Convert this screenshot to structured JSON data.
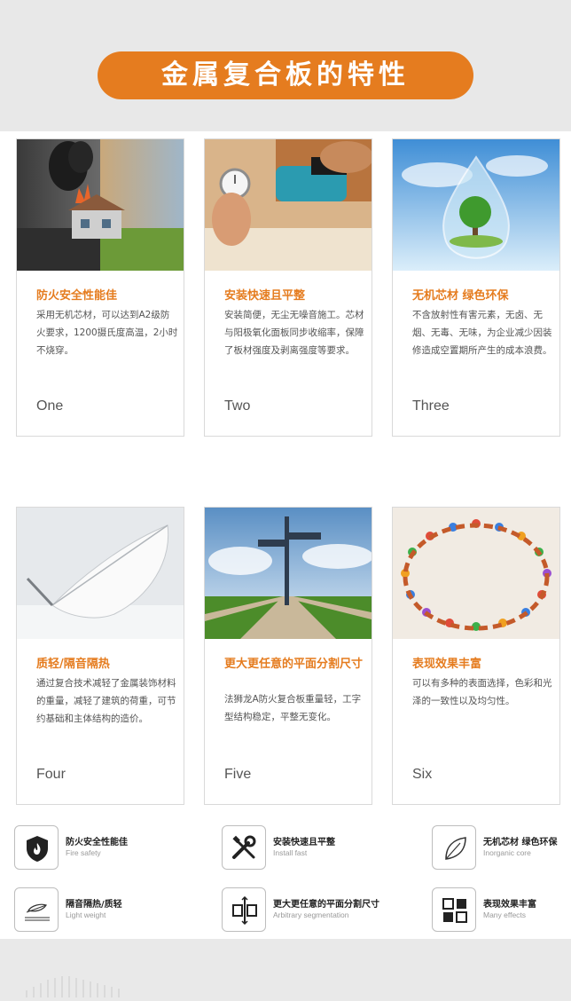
{
  "title": "金属复合板的特性",
  "cards": [
    {
      "title": "防火安全性能佳",
      "desc": "采用无机芯材，可以达到A2级防火要求，1200摄氏度高温，2小时不烧穿。",
      "num": "One"
    },
    {
      "title": "安装快速且平整",
      "desc": "安装简便，无尘无噪音施工。芯材与阳极氧化面板同步收缩率，保障了板材强度及剥离强度等要求。",
      "num": "Two"
    },
    {
      "title": "无机芯材 绿色环保",
      "desc": "不含放射性有害元素，无卤、无烟、无毒、无味，为企业减少因装修造成空置期所产生的成本浪费。",
      "num": "Three"
    },
    {
      "title": "质轻/隔音隔热",
      "desc": "通过复合技术减轻了金属装饰材料的重量，减轻了建筑的荷重，可节约基础和主体结构的造价。",
      "num": "Four"
    },
    {
      "title": "更大更任意的平面分割尺寸",
      "desc": "法狮龙A防火复合板重量轻，工字型结构稳定，平整无变化。",
      "num": "Five"
    },
    {
      "title": "表现效果丰富",
      "desc": "可以有多种的表面选择，色彩和光泽的一致性以及均匀性。",
      "num": "Six"
    }
  ],
  "features": [
    {
      "name": "防火安全性能佳",
      "en": "Fire safety",
      "icon": "shield-flame-icon"
    },
    {
      "name": "安装快速且平整",
      "en": "Install fast",
      "icon": "tools-icon"
    },
    {
      "name": "无机芯材 绿色环保",
      "en": "Inorganic core",
      "icon": "leaf-icon"
    },
    {
      "name": "隔音隔热/质轻",
      "en": "Light weight",
      "icon": "feather-icon"
    },
    {
      "name": "更大更任意的平面分割尺寸",
      "en": "Arbitrary segmentation",
      "icon": "segmentation-icon"
    },
    {
      "name": "表现效果丰富",
      "en": "Many effects",
      "icon": "grid-icon"
    }
  ],
  "colors": {
    "accent": "#e57c1f",
    "header_bg": "#e8e8e8",
    "text": "#555555"
  }
}
